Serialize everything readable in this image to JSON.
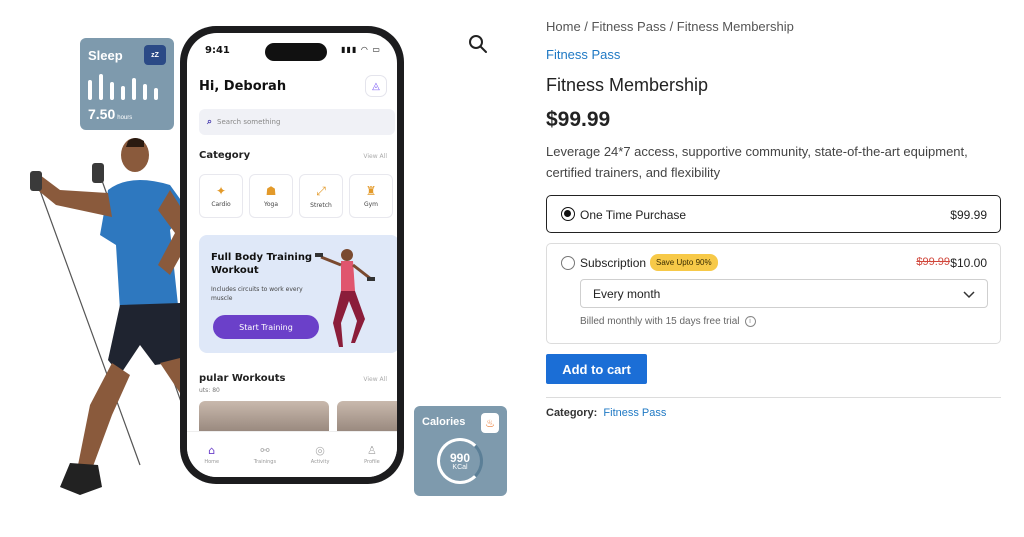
{
  "breadcrumb": {
    "home": "Home",
    "sep1": " / ",
    "category": "Fitness Pass",
    "sep2": " / ",
    "current": "Fitness Membership"
  },
  "product": {
    "category_link": "Fitness Pass",
    "title": "Fitness Membership",
    "price": "$99.99",
    "description": "Leverage 24*7 access, supportive community, state-of-the-art equipment, certified trainers, and flexibility"
  },
  "purchase_options": {
    "one_time": {
      "label": "One Time Purchase",
      "price": "$99.99",
      "selected": true
    },
    "subscription": {
      "label": "Subscription",
      "badge": "Save Upto 90%",
      "old_price": "$99.99",
      "price": "$10.00",
      "frequency": "Every month",
      "billing_note": "Billed monthly with 15 days free trial",
      "selected": false
    }
  },
  "actions": {
    "add_to_cart": "Add to cart"
  },
  "meta": {
    "category_label": "Category:",
    "category_value": "Fitness Pass"
  },
  "product_image": {
    "phone": {
      "time": "9:41",
      "greeting": "Hi, Deborah",
      "search_placeholder": "Search something",
      "category_title": "Category",
      "view_all": "View All",
      "categories": [
        "Cardio",
        "Yoga",
        "Stretch",
        "Gym"
      ],
      "banner": {
        "title": "Full Body Training Workout",
        "description": "Includes circuits to work every muscle",
        "button": "Start Training"
      },
      "popular_title": "pular Workouts",
      "popular_sub": "uts: 80",
      "tabs": [
        "Home",
        "Trainings",
        "Activity",
        "Profile"
      ]
    },
    "sleep_card": {
      "title": "Sleep",
      "icon_text": "zZ",
      "value": "7.50",
      "unit": "hours"
    },
    "calories_card": {
      "title": "Calories",
      "value": "990",
      "unit": "KCal"
    }
  },
  "colors": {
    "link": "#1f79c4",
    "button": "#1b6ed6",
    "badge": "#f7c948",
    "card": "#7e9aad",
    "phone_accent": "#6b40c9"
  },
  "icons": {
    "search": "magnifier-icon",
    "chevron": "chevron-down-icon",
    "info": "info-icon"
  }
}
